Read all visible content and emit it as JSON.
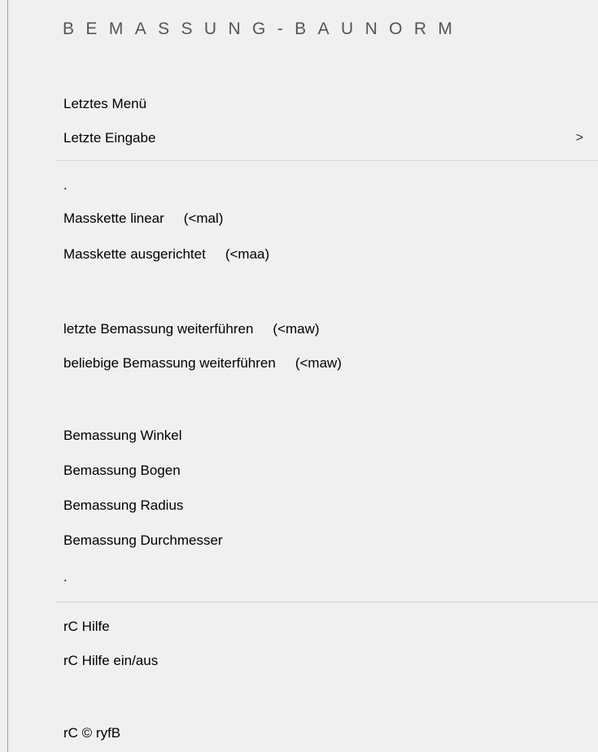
{
  "menu": {
    "title": "BEMASSUNG-BAUNORM",
    "top_items": [
      {
        "label": "Letztes Menü"
      },
      {
        "label": "Letzte Eingabe",
        "submenu_arrow": ">"
      }
    ],
    "dot_top": ".",
    "items_group1": [
      {
        "label": "Masskette linear",
        "shortcut": "(<mal)"
      },
      {
        "label": "Masskette ausgerichtet",
        "shortcut": "(<maa)"
      }
    ],
    "items_group2": [
      {
        "label": "letzte Bemassung weiterführen",
        "shortcut": "(<maw)"
      },
      {
        "label": "beliebige Bemassung weiterführen",
        "shortcut": "(<maw)"
      }
    ],
    "items_group3": [
      {
        "label": "Bemassung Winkel"
      },
      {
        "label": "Bemassung Bogen"
      },
      {
        "label": "Bemassung Radius"
      },
      {
        "label": "Bemassung Durchmesser"
      }
    ],
    "dot_bottom": ".",
    "help_items": [
      {
        "label": "rC Hilfe"
      },
      {
        "label": "rC Hilfe ein/aus"
      }
    ],
    "copyright_item": {
      "label": "rC © ryfB"
    }
  }
}
